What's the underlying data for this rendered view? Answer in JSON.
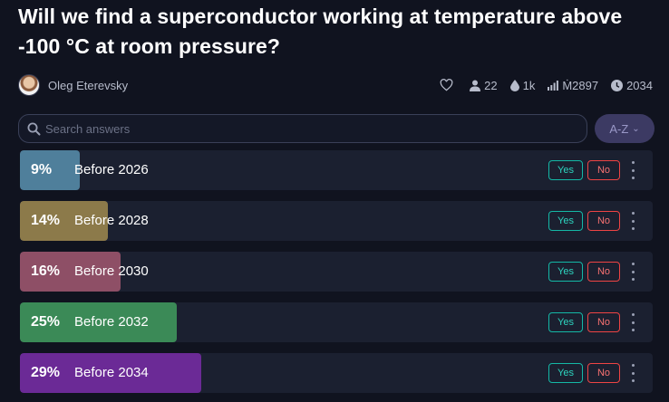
{
  "question": {
    "title": "Will we find a superconductor working at temperature above -100 °C at room pressure?"
  },
  "author": {
    "name": "Oleg Eterevsky"
  },
  "stats": {
    "traders": "22",
    "liquidity": "1k",
    "volume": "Ṁ2897",
    "close_year": "2034",
    "icons": [
      "heart-icon",
      "user-icon",
      "droplet-icon",
      "bar-chart-icon",
      "clock-icon"
    ]
  },
  "search": {
    "placeholder": "Search answers",
    "value": ""
  },
  "sort": {
    "label": "A-Z"
  },
  "colors": {
    "background": "#10131f",
    "row_background": "#1b2030",
    "yes": "#14b8a6",
    "no": "#ef4444"
  },
  "answers": [
    {
      "prob_label": "9%",
      "probability": 0.09,
      "text": "Before 2026",
      "color": "#4f7f9b",
      "yes_label": "Yes",
      "no_label": "No"
    },
    {
      "prob_label": "14%",
      "probability": 0.14,
      "text": "Before 2028",
      "color": "#8c7a4a",
      "yes_label": "Yes",
      "no_label": "No"
    },
    {
      "prob_label": "16%",
      "probability": 0.16,
      "text": "Before 2030",
      "color": "#8e4f66",
      "yes_label": "Yes",
      "no_label": "No"
    },
    {
      "prob_label": "25%",
      "probability": 0.25,
      "text": "Before 2032",
      "color": "#3b8a57",
      "yes_label": "Yes",
      "no_label": "No"
    },
    {
      "prob_label": "29%",
      "probability": 0.29,
      "text": "Before 2034",
      "color": "#6b2a96",
      "yes_label": "Yes",
      "no_label": "No"
    }
  ]
}
